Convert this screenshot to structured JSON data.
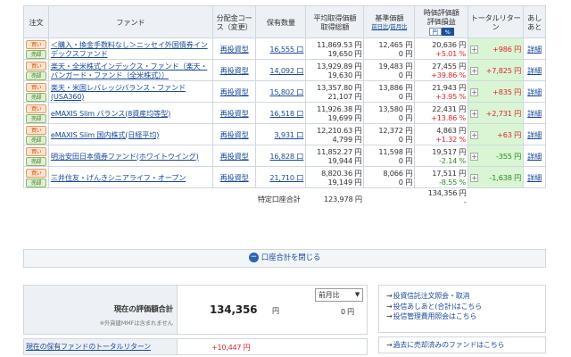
{
  "headers": {
    "order": "注文",
    "fund": "ファンド",
    "course": "分配金コース（変更）",
    "qty": "保有数量",
    "avg_price": "平均取得価額",
    "avg_price2": "取得総額",
    "base_price": "基準価額",
    "base_sub_prev": "前日比",
    "base_sub_sep": "/",
    "base_sub_month": "前月比",
    "valuation": "時価評価額",
    "valuation2": "評価損益",
    "unit_yen": "円",
    "unit_pct": "%",
    "total_return": "トータルリターン",
    "memo": "あしあと"
  },
  "buttons": {
    "buy": "買い",
    "sell": "売却"
  },
  "detail_label": "詳細",
  "funds": [
    {
      "name": "＜購入・換金手数料なし＞ニッセイ外国債券インデックスファンド",
      "course": "再投資型",
      "qty": "16,555 口",
      "avg": "11,869.53 円",
      "total_cost": "19,650 円",
      "base": "12,465 円",
      "base_change": "0 円",
      "value": "20,636 円",
      "gain": "+5.01 %",
      "gain_sign": "pos",
      "tr": "+986 円",
      "tr_sign": "pos"
    },
    {
      "name": "楽天・全米株式インデックス・ファンド（楽天・バンガード・ファンド（全米株式））",
      "course": "再投資型",
      "qty": "14,092 口",
      "avg": "13,929.89 円",
      "total_cost": "19,630 円",
      "base": "19,483 円",
      "base_change": "0 円",
      "value": "27,455 円",
      "gain": "+39.86 %",
      "gain_sign": "pos",
      "tr": "+7,825 円",
      "tr_sign": "pos"
    },
    {
      "name": "楽天・米国レバレッジバランス・ファンド(USA360)",
      "course": "再投資型",
      "qty": "15,802 口",
      "avg": "13,357.80 円",
      "total_cost": "21,107 円",
      "base": "13,886 円",
      "base_change": "0 円",
      "value": "21,943 円",
      "gain": "+3.95 %",
      "gain_sign": "pos",
      "tr": "+835 円",
      "tr_sign": "pos"
    },
    {
      "name": "eMAXIS Slim バランス(8資産均等型)",
      "course": "再投資型",
      "qty": "16,518 口",
      "avg": "11,926.38 円",
      "total_cost": "19,699 円",
      "base": "13,580 円",
      "base_change": "0 円",
      "value": "22,431 円",
      "gain": "+13.86 %",
      "gain_sign": "pos",
      "tr": "+2,731 円",
      "tr_sign": "pos"
    },
    {
      "name": "eMAXIS Slim 国内株式(日経平均)",
      "course": "再投資型",
      "qty": "3,931 口",
      "avg": "12,210.63 円",
      "total_cost": "4,799 円",
      "base": "12,372 円",
      "base_change": "0 円",
      "value": "4,863 円",
      "gain": "+1.32 %",
      "gain_sign": "pos",
      "tr": "+63 円",
      "tr_sign": "pos"
    },
    {
      "name": "明治安田日本債券ファンド(ホワイトウイング)",
      "course": "再投資型",
      "qty": "16,828 口",
      "avg": "11,852.27 円",
      "total_cost": "19,944 円",
      "base": "11,598 円",
      "base_change": "0 円",
      "value": "19,517 円",
      "gain": "-2.14 %",
      "gain_sign": "neg",
      "tr": "-355 円",
      "tr_sign": "neg"
    },
    {
      "name": "三井住友・げんきシニアライフ・オープン",
      "course": "再投資型",
      "qty": "21,710 口",
      "avg": "8,820.36 円",
      "total_cost": "19,149 円",
      "base": "8,066 円",
      "base_change": "0 円",
      "value": "17,511 円",
      "gain": "-8.55 %",
      "gain_sign": "neg",
      "tr": "-1,638 円",
      "tr_sign": "neg"
    }
  ],
  "subtotal": {
    "label": "特定口座合計",
    "cost": "123,978 円",
    "value": "134,356 円",
    "dash": "-"
  },
  "collapse_label": "口座合計を閉じる",
  "summary": {
    "label": "現在の評価額合計",
    "note": "※外貨建MMFは含まれません",
    "value": "134,356",
    "unit": "円",
    "select_value": "前月比",
    "diff": "0 円",
    "tr_label": "現在の保有ファンドのトータルリターン",
    "tr_value": "+10,447 円"
  },
  "links": [
    "投資信託注文照会・取消",
    "投信あしあと(合計)はこちら",
    "投信管理費用照会はこちら"
  ],
  "past_link": "過去に売却済みのファンドはこちら",
  "colors": {
    "gain_pos": "#e0262f",
    "gain_neg": "#2c8a25",
    "total_return_bg": "#d9f5d4",
    "link": "#1a4a9c"
  }
}
